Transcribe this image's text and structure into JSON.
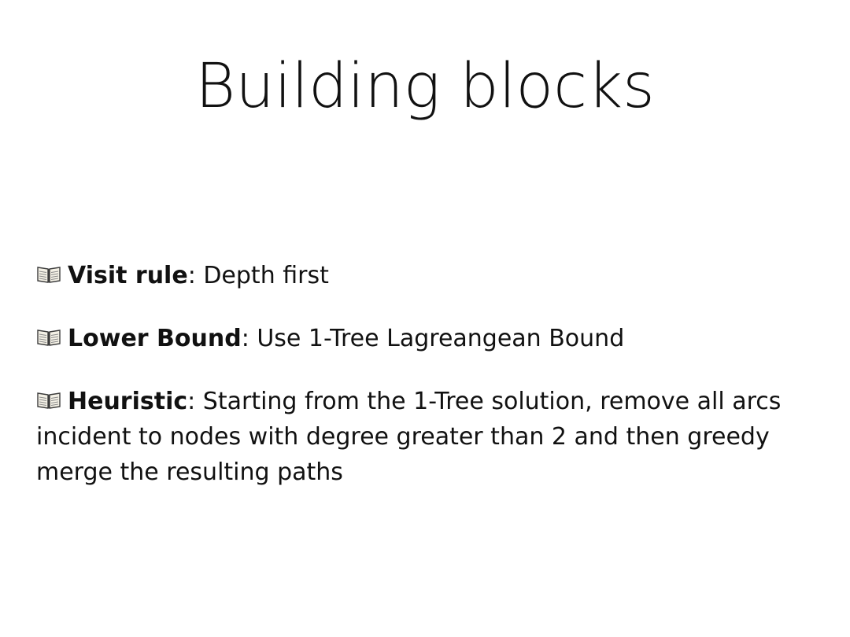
{
  "slide": {
    "title": "Building blocks",
    "bullets": [
      {
        "icon": "open-book-icon",
        "label": "Visit rule",
        "text": ": Depth first"
      },
      {
        "icon": "open-book-icon",
        "label": "Lower Bound",
        "text": ": Use 1-Tree Lagreangean Bound"
      },
      {
        "icon": "open-book-icon",
        "label": "Heuristic",
        "text": ": Starting from the 1-Tree solution, remove all arcs incident to nodes with degree greater than 2 and then greedy merge the resulting paths"
      }
    ]
  }
}
